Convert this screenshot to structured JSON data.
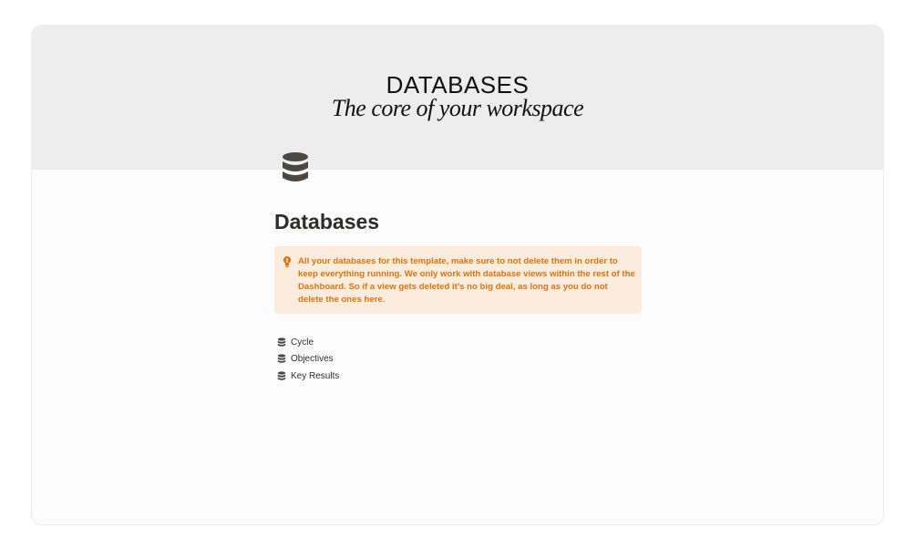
{
  "cover": {
    "title": "DATABASES",
    "subtitle": "The core of your workspace",
    "background_color": "#ededed"
  },
  "page": {
    "icon": "database-icon",
    "title": "Databases"
  },
  "callout": {
    "icon": "lightbulb-icon",
    "text": "All your databases for this template, make sure to not delete them in order to keep everything running. We only work with database views within the rest of the Dashboard. So if a view gets deleted it’s no big deal, as long as you do not delete the ones here.",
    "background_color": "#fbecdd",
    "text_color": "#d9730d"
  },
  "databases": [
    {
      "icon": "database-icon",
      "label": "Cycle"
    },
    {
      "icon": "database-icon",
      "label": "Objectives"
    },
    {
      "icon": "database-icon",
      "label": "Key Results"
    }
  ]
}
